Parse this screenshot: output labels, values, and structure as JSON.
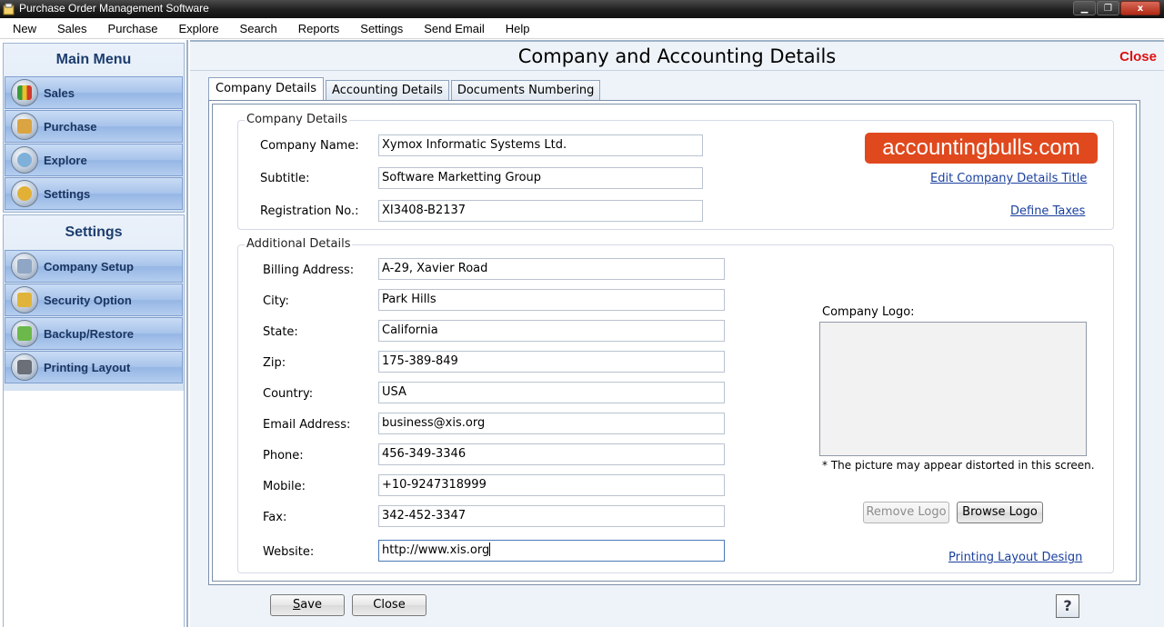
{
  "window": {
    "title": "Purchase Order Management Software",
    "app_icon": "app-icon",
    "controls": {
      "minimize": "minimize-icon",
      "maximize": "maximize-icon",
      "close_symbol": "x"
    }
  },
  "menubar": {
    "items": [
      "New",
      "Sales",
      "Purchase",
      "Explore",
      "Search",
      "Reports",
      "Settings",
      "Send Email",
      "Help"
    ]
  },
  "sidebar": {
    "main_menu_title": "Main Menu",
    "main_items": [
      {
        "label": "Sales",
        "icon": "sales-chart-icon"
      },
      {
        "label": "Purchase",
        "icon": "purchase-box-icon"
      },
      {
        "label": "Explore",
        "icon": "explore-icon"
      },
      {
        "label": "Settings",
        "icon": "settings-gear-icon"
      }
    ],
    "settings_title": "Settings",
    "settings_items": [
      {
        "label": "Company Setup",
        "icon": "company-setup-icon"
      },
      {
        "label": "Security Option",
        "icon": "lock-icon"
      },
      {
        "label": "Backup/Restore",
        "icon": "backup-icon"
      },
      {
        "label": "Printing Layout",
        "icon": "printer-icon"
      }
    ]
  },
  "main": {
    "title": "Company and Accounting Details",
    "close_link": "Close",
    "tabs": [
      "Company Details",
      "Accounting Details",
      "Documents Numbering"
    ],
    "active_tab": "Company Details",
    "company_group": {
      "legend": "Company Details",
      "fields": [
        {
          "label": "Company Name:",
          "value": "Xymox Informatic Systems Ltd."
        },
        {
          "label": "Subtitle:",
          "value": "Software Marketting Group"
        },
        {
          "label": "Registration No.:",
          "value": "XI3408-B2137"
        }
      ],
      "brand_logo_text": "accountingbulls.com",
      "edit_title_link": "Edit Company Details Title",
      "define_taxes_link": "Define Taxes"
    },
    "additional_group": {
      "legend": "Additional Details",
      "fields": [
        {
          "label": "Billing Address:",
          "value": "A-29, Xavier Road"
        },
        {
          "label": "City:",
          "value": "Park Hills"
        },
        {
          "label": "State:",
          "value": "California"
        },
        {
          "label": "Zip:",
          "value": "175-389-849"
        },
        {
          "label": "Country:",
          "value": "USA"
        },
        {
          "label": "Email Address:",
          "value": "business@xis.org"
        },
        {
          "label": "Phone:",
          "value": "456-349-3346"
        },
        {
          "label": "Mobile:",
          "value": "+10-9247318999"
        },
        {
          "label": "Fax:",
          "value": "342-452-3347"
        },
        {
          "label": "Website:",
          "value": "http://www.xis.org"
        }
      ],
      "logo_label": "Company Logo:",
      "logo_note": "* The picture may appear distorted in this screen.",
      "remove_logo": "Remove Logo",
      "browse_logo": "Browse Logo",
      "printing_layout_link": "Printing Layout Design"
    },
    "footer": {
      "save": "Save",
      "close": "Close",
      "help": "?"
    }
  }
}
